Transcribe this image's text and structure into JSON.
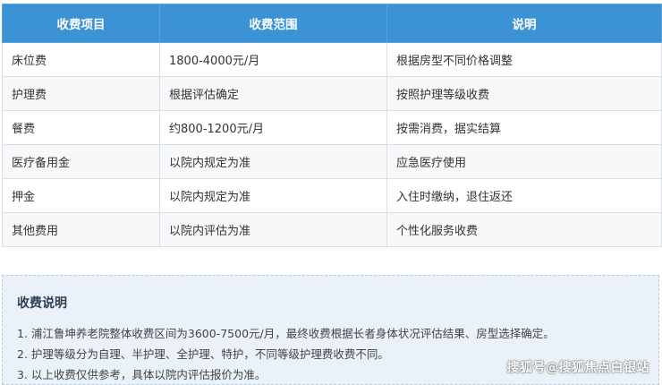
{
  "table": {
    "headers": [
      "收费项目",
      "收费范围",
      "说明"
    ],
    "rows": [
      [
        "床位费",
        "1800-4000元/月",
        "根据房型不同价格调整"
      ],
      [
        "护理费",
        "根据评估确定",
        "按照护理等级收费"
      ],
      [
        "餐费",
        "约800-1200元/月",
        "按需消费，据实结算"
      ],
      [
        "医疗备用金",
        "以院内规定为准",
        "应急医疗使用"
      ],
      [
        "押金",
        "以院内规定为准",
        "入住时缴纳，退住返还"
      ],
      [
        "其他费用",
        "以院内评估为准",
        "个性化服务收费"
      ]
    ]
  },
  "notes": {
    "title": "收费说明",
    "items": [
      "1. 浦江鲁坤养老院整体收费区间为3600-7500元/月，最终收费根据长者身体状况评估结果、房型选择确定。",
      "2. 护理等级分为自理、半护理、全护理、特护，不同等级护理费收费不同。",
      "3. 以上收费仅供参考，具体以院内评估报价为准。"
    ]
  },
  "watermark": "搜狐号@搜狐焦点白银站",
  "colors": {
    "header_bg": "#3b93d6",
    "notes_bg": "#eaf1f8"
  }
}
